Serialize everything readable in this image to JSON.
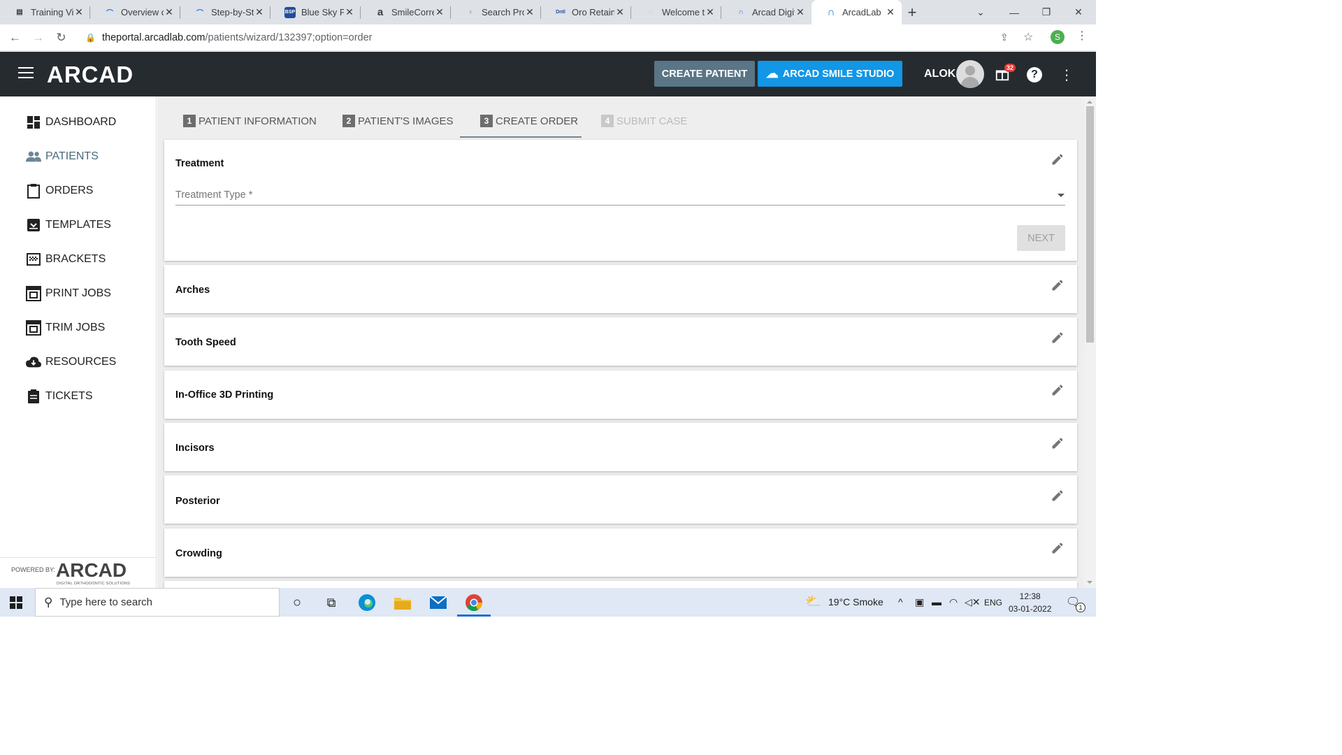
{
  "browser": {
    "tabs": [
      {
        "title": "Training Vid",
        "icon": "doc-icon"
      },
      {
        "title": "Overview of",
        "icon": "arc-icon"
      },
      {
        "title": "Step-by-Ste",
        "icon": "arc-icon"
      },
      {
        "title": "Blue Sky Pla",
        "icon": "bsp-icon"
      },
      {
        "title": "SmileCorrec",
        "icon": "amazon-icon"
      },
      {
        "title": "Search Prod",
        "icon": "tooth-icon"
      },
      {
        "title": "Oro Retaine",
        "icon": "dental-icon"
      },
      {
        "title": "Welcome to",
        "icon": "page-icon"
      },
      {
        "title": "Arcad Digit",
        "icon": "arcad-icon"
      },
      {
        "title": "ArcadLab",
        "icon": "arcad-icon"
      }
    ],
    "url_host": "theportal.arcadlab.com",
    "url_path": "/patients/wizard/132397;option=order",
    "profile_initial": "S"
  },
  "header": {
    "logo": "ARCAD",
    "create_patient": "CREATE PATIENT",
    "smile_studio": "ARCAD SMILE STUDIO",
    "user": "ALOK",
    "notifications": "32"
  },
  "sidebar": {
    "items": [
      {
        "label": "DASHBOARD",
        "icon": "dashboard-icon"
      },
      {
        "label": "PATIENTS",
        "icon": "people-icon"
      },
      {
        "label": "ORDERS",
        "icon": "clipboard-icon"
      },
      {
        "label": "TEMPLATES",
        "icon": "archive-icon"
      },
      {
        "label": "BRACKETS",
        "icon": "grid-icon"
      },
      {
        "label": "PRINT JOBS",
        "icon": "printer-icon"
      },
      {
        "label": "TRIM JOBS",
        "icon": "printer-icon"
      },
      {
        "label": "RESOURCES",
        "icon": "cloud-download-icon"
      },
      {
        "label": "TICKETS",
        "icon": "ticket-icon"
      }
    ],
    "active": "PATIENTS",
    "powered_by": "POWERED BY:",
    "powered_logo": "ARCAD",
    "powered_sub": "DIGITAL ORTHODONTIC SOLUTIONS"
  },
  "wizard": {
    "steps": [
      {
        "num": "1",
        "label": "PATIENT INFORMATION",
        "state": "done"
      },
      {
        "num": "2",
        "label": "PATIENT'S IMAGES",
        "state": "done"
      },
      {
        "num": "3",
        "label": "CREATE ORDER",
        "state": "active"
      },
      {
        "num": "4",
        "label": "SUBMIT CASE",
        "state": "disabled"
      }
    ]
  },
  "treatment": {
    "title": "Treatment",
    "field_label": "Treatment Type *",
    "next": "NEXT"
  },
  "sections": [
    "Arches",
    "Tooth Speed",
    "In-Office 3D Printing",
    "Incisors",
    "Posterior",
    "Crowding"
  ],
  "taskbar": {
    "search_placeholder": "Type here to search",
    "weather": "19°C  Smoke",
    "lang": "ENG",
    "time": "12:38",
    "date": "03-01-2022",
    "notif_count": "1"
  }
}
